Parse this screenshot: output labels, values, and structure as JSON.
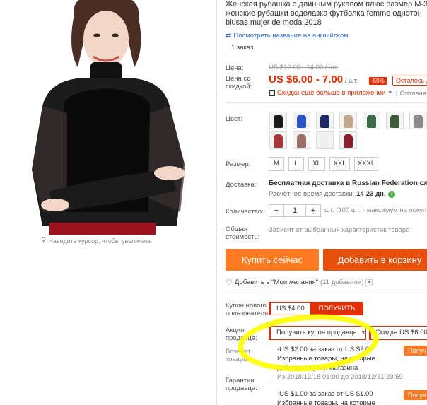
{
  "product": {
    "title_lines": [
      "Женская рубашка с длинным рукавом плюс размер М-3",
      "женские рубашки водолазка футболка femme однотон",
      "blusas mujer de moda 2018"
    ],
    "translate_link": "Посмотреть название на английском",
    "orders": "1 заказ"
  },
  "image": {
    "zoom_hint": "Наведите курсор, чтобы увеличить"
  },
  "price": {
    "label_price": "Цена:",
    "label_discount_line1": "Цена со",
    "label_discount_line2": "скидкой:",
    "old": "US $12.00 - 14.00 / шт.",
    "new": "US $6.00 - 7.00",
    "unit": " / шт.",
    "discount_pct": "-50%",
    "time_left": "Осталось д",
    "app_promo": "Скидки ещё больше в приложении",
    "wholesale": "Оптовая"
  },
  "color": {
    "label": "Цвет:",
    "swatches": [
      "#1a1a1a",
      "#2a54c8",
      "#1d2a66",
      "#c2a88a",
      "#3c6b4c",
      "#3e5a3a",
      "#8a8a8a",
      "#a8353a",
      "#9b6f64",
      "#eeeeee",
      "#8a1f2a"
    ]
  },
  "size": {
    "label": "Размер:",
    "options": [
      "M",
      "L",
      "XL",
      "XXL",
      "XXXL"
    ]
  },
  "shipping": {
    "label": "Доставка:",
    "main": "Бесплатная доставка в Russian Federation службой",
    "time_prefix": "Расчётное время доставки:",
    "time_value": "14-23 дн."
  },
  "quantity": {
    "label": "Количество:",
    "minus": "−",
    "value": "1",
    "plus": "+",
    "info": "шт. (100 шт. - максимум на покупат"
  },
  "total": {
    "label_line1": "Общая",
    "label_line2": "стоимость:",
    "note": "Зависит от выбранных характеристик товара"
  },
  "actions": {
    "buy": "Купить сейчас",
    "cart": "Добавить в корзину",
    "wishlist": "Добавить в \"Мои желания\"",
    "wishlist_count": "(11 добавили)"
  },
  "coupons": {
    "new_user_label_line1": "Купон нового",
    "new_user_label_line2": "пользователя",
    "new_user_value": "US $4.00",
    "new_user_get": "ПОЛУЧИТЬ",
    "seller_label_line1": "Акция",
    "seller_label_line2": "продавца:",
    "seller_dropdown": "Получить купон продавца",
    "store_discount": "Скидка US $6.00 з",
    "items": [
      {
        "line1": "-US $2.00 за заказ от US $2.00",
        "line2": "Избранные товары, на которые",
        "line3": "действует купон магазина",
        "valid": "Из 2018/12/18 01:00 до 2018/12/31 23:59",
        "get": "Получ"
      },
      {
        "line1": "-US $1.00 за заказ от US $1.00",
        "line2": "Избранные товары, на которые",
        "get": "Получ"
      }
    ]
  },
  "return": {
    "label_line1": "Возврат",
    "label_line2": "товара"
  },
  "guarantee": {
    "label_line1": "Гарантии",
    "label_line2": "продавца:"
  }
}
